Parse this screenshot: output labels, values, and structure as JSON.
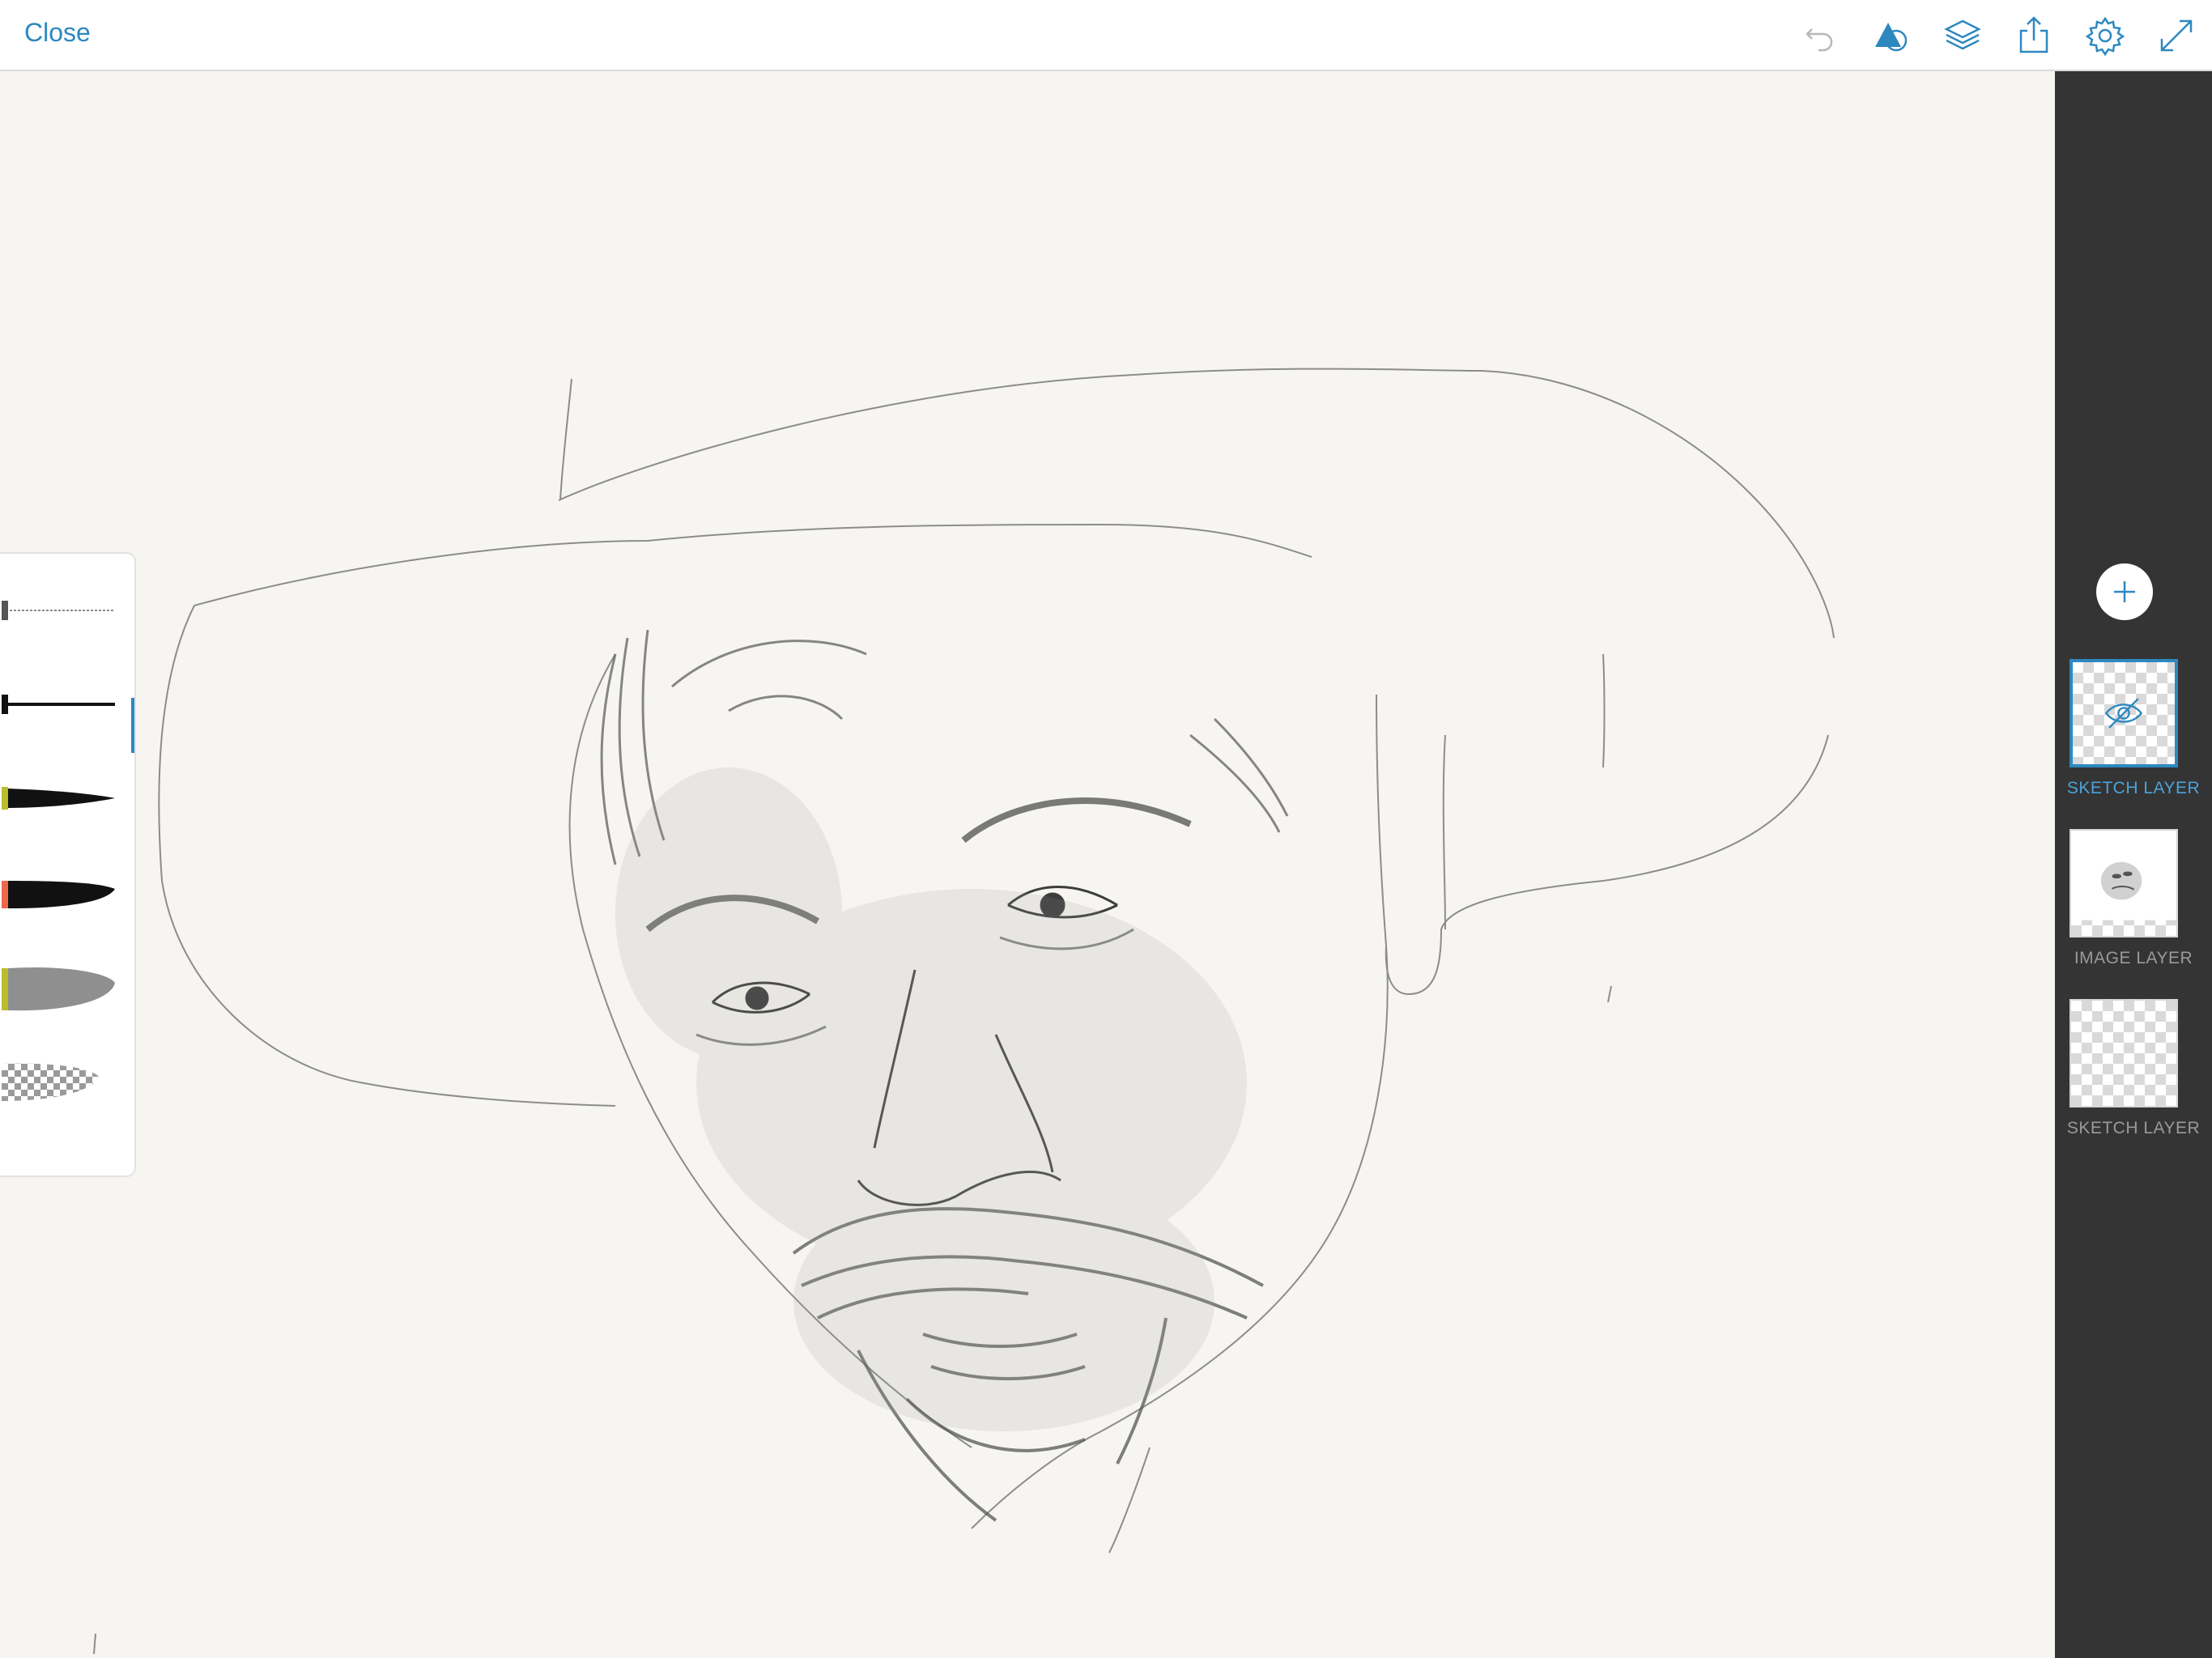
{
  "header": {
    "close_label": "Close",
    "icons": [
      "undo-icon",
      "shape-icon",
      "layers-icon",
      "share-icon",
      "settings-icon",
      "fullscreen-icon"
    ],
    "accent_color": "#2d88c0"
  },
  "brushes": {
    "items": [
      {
        "name": "fine-pencil-brush",
        "tip_color": "#555555"
      },
      {
        "name": "round-pen-brush",
        "tip_color": "#111111",
        "selected": true
      },
      {
        "name": "tapered-ink-brush",
        "tip_color": "#b9bc2b"
      },
      {
        "name": "marker-brush",
        "tip_color": "#f0684a"
      },
      {
        "name": "wash-brush",
        "tip_color": "#b9bc2b"
      },
      {
        "name": "eraser-brush",
        "tip_color": "#cccccc"
      }
    ]
  },
  "layers": {
    "add_icon": "plus-icon",
    "items": [
      {
        "label": "SKETCH LAYER",
        "selected": true,
        "hidden_icon": "eye-slash-icon"
      },
      {
        "label": "IMAGE LAYER",
        "selected": false
      },
      {
        "label": "SKETCH LAYER",
        "selected": false
      }
    ],
    "panel_color": "#343434"
  }
}
